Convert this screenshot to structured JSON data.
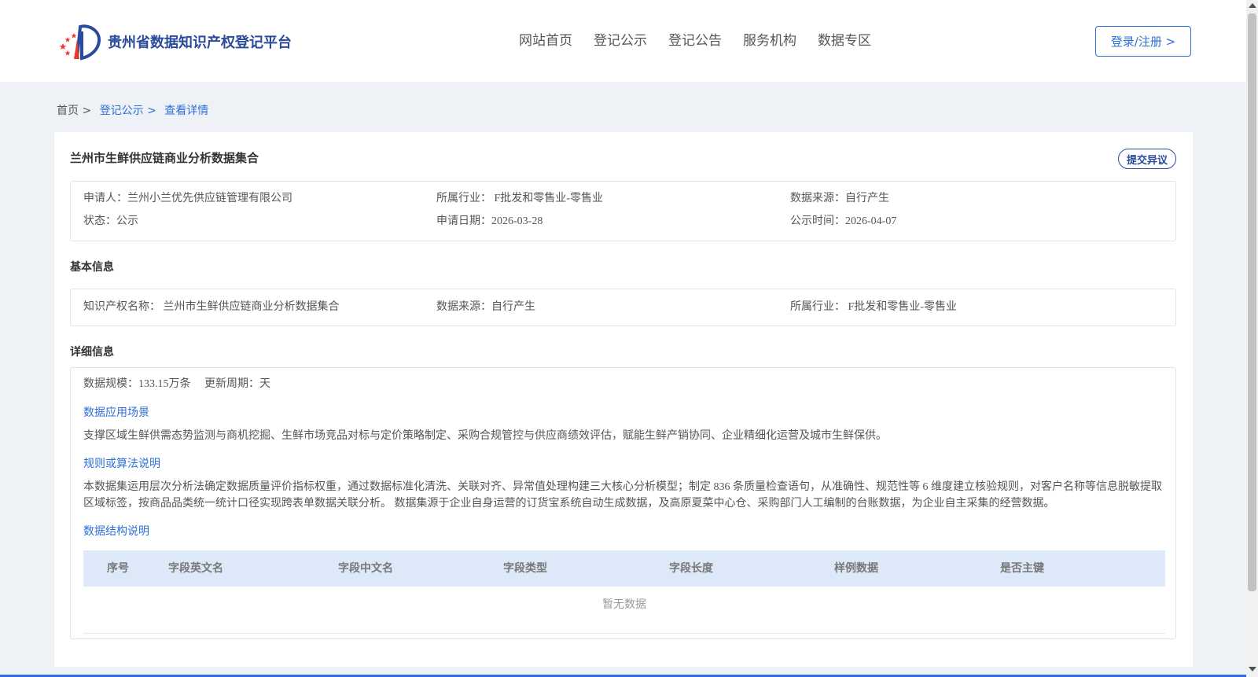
{
  "header": {
    "site_name": "贵州省数据知识产权登记平台",
    "logo_icon": "stars-flag-logo-icon",
    "nav": [
      "网站首页",
      "登记公示",
      "登记公告",
      "服务机构",
      "数据专区"
    ],
    "login_label": "登录/注册 >"
  },
  "breadcrumb": {
    "home": "首页 >",
    "level1": "登记公示 >",
    "level2": "查看详情"
  },
  "detail": {
    "title": "兰州市生鲜供应链商业分析数据集合",
    "objection_label": "提交异议",
    "summary": {
      "applicant": "申请人：兰州小兰优先供应链管理有限公司",
      "industry": "所属行业： F批发和零售业-零售业",
      "source": "数据来源：自行产生",
      "status": "状态：公示",
      "apply_date": "申请日期：2026-03-28",
      "publish_date": "公示时间：2026-04-07"
    },
    "basic_title": "基本信息",
    "basic": {
      "ip_name": "知识产权名称： 兰州市生鲜供应链商业分析数据集合",
      "source": "数据来源：自行产生",
      "industry": "所属行业： F批发和零售业-零售业"
    },
    "detail_title": "详细信息",
    "scale": "数据规模：133.15万条",
    "cycle": "更新周期：天",
    "scenario_title": "数据应用场景",
    "scenario_text": "支撑区域生鲜供需态势监测与商机挖掘、生鲜市场竞品对标与定价策略制定、采购合规管控与供应商绩效评估，赋能生鲜产销协同、企业精细化运营及城市生鲜保供。",
    "rule_title": "规则或算法说明",
    "rule_text": "本数据集运用层次分析法确定数据质量评价指标权重，通过数据标准化清洗、关联对齐、异常值处理构建三大核心分析模型；制定 836 条质量检查语句，从准确性、规范性等 6 维度建立核验规则，对客户名称等信息脱敏提取区域标签，按商品品类统一统计口径实现跨表单数据关联分析。 数据集源于企业自身运营的订货宝系统自动生成数据，及高原夏菜中心仓、采购部门人工编制的台账数据，为企业自主采集的经营数据。",
    "structure_title": "数据结构说明",
    "table_headers": [
      "序号",
      "字段英文名",
      "字段中文名",
      "字段类型",
      "字段长度",
      "样例数据",
      "是否主键"
    ],
    "empty_text": "暂无数据"
  },
  "colors": {
    "accent": "#2d6fd6",
    "brand": "#2a4a9b",
    "table_header_bg": "#dde9f8"
  }
}
